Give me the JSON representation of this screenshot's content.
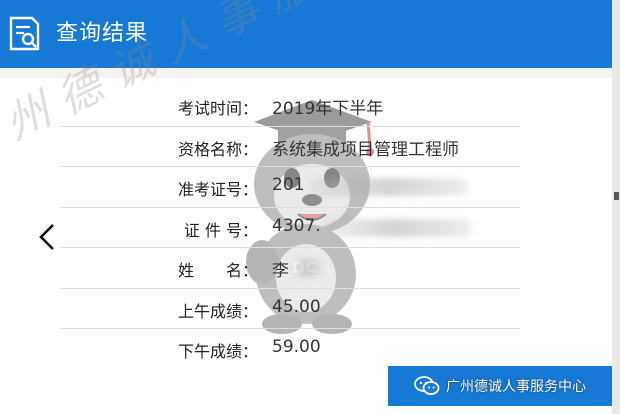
{
  "header": {
    "title": "查询结果"
  },
  "watermark": "广州德诚人事服务中心",
  "result": {
    "rows": [
      {
        "label": "考试时间：",
        "value": "2019年下半年"
      },
      {
        "label": "资格名称：",
        "value": "系统集成项目管理工程师"
      },
      {
        "label": "准考证号：",
        "value": "201"
      },
      {
        "label": "证 件 号：",
        "value": "4307."
      },
      {
        "label": "姓　　名：",
        "value": "李"
      },
      {
        "label": "上午成绩：",
        "value": "45.00"
      },
      {
        "label": "下午成绩：",
        "value": "59.00"
      }
    ]
  },
  "mascot": {
    "badge": "DC"
  },
  "footer": {
    "button_label": "返回",
    "wechat_account": "广州德诚人事服务中心"
  },
  "icons": {
    "header": "document-search-icon",
    "nav_prev": "chevron-left-icon",
    "wechat": "wechat-icon"
  },
  "colors": {
    "accent": "#1779d6",
    "background": "#f3f3f3"
  }
}
